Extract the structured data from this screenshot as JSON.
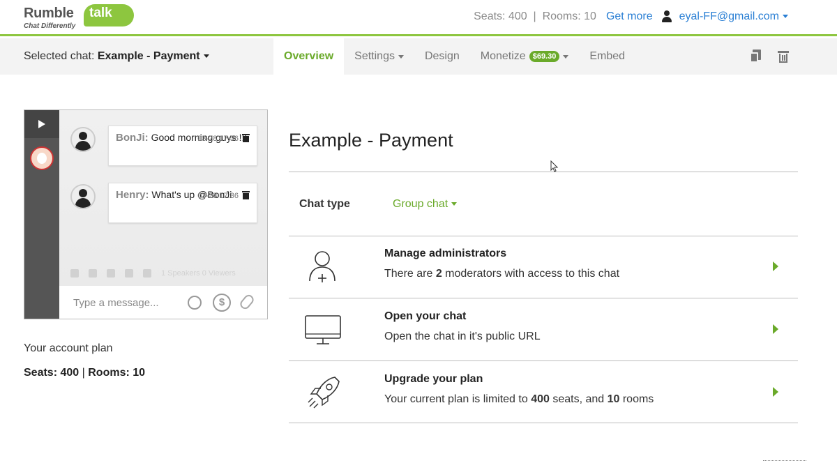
{
  "header": {
    "logo_brand": "Rumble",
    "logo_talk": "talk",
    "logo_tagline": "Chat Differently",
    "seats_info": "Seats: 400  |  Rooms: 10",
    "get_more": "Get more",
    "user_email": "eyal-FF@gmail.com"
  },
  "subnav": {
    "selected_label": "Selected chat:",
    "selected_chat": "Example - Payment",
    "tabs": [
      {
        "label": "Overview",
        "active": true
      },
      {
        "label": "Settings",
        "dropdown": true
      },
      {
        "label": "Design"
      },
      {
        "label": "Monetize",
        "badge": "$69.30",
        "dropdown": true
      },
      {
        "label": "Embed"
      }
    ],
    "icons": [
      "copy-icon",
      "trash-icon"
    ]
  },
  "preview": {
    "messages": [
      {
        "name": "BonJi:",
        "text": "Good morning guys !!!",
        "time": "03-28 17:36"
      },
      {
        "name": "Henry:",
        "text": "What's up @BonJi",
        "time": "03-28 17:36"
      }
    ],
    "toolbar_text": "1 Speakers  0 Viewers",
    "input_placeholder": "Type a message...",
    "dollar_symbol": "$"
  },
  "account": {
    "label": "Your account plan",
    "seats_label": "Seats:",
    "seats": "400",
    "rooms_label": "Rooms:",
    "rooms": "10"
  },
  "overview": {
    "title": "Example - Payment",
    "chat_type_label": "Chat type",
    "chat_type_value": "Group chat",
    "rows": [
      {
        "title": "Manage administrators",
        "desc_pre": "There are ",
        "desc_bold": "2",
        "desc_post": " moderators with access to this chat",
        "icon": "user-add-icon"
      },
      {
        "title": "Open your chat",
        "desc": "Open the chat in it's public URL",
        "icon": "monitor-icon"
      },
      {
        "title": "Upgrade your plan",
        "desc_pre": "Your current plan is limited to ",
        "desc_bold": "400",
        "desc_mid": " seats, and ",
        "desc_bold2": "10",
        "desc_post": " rooms",
        "icon": "rocket-icon"
      }
    ]
  },
  "colors": {
    "accent_green": "#6aaa2a",
    "link_blue": "#2a7fd4"
  }
}
